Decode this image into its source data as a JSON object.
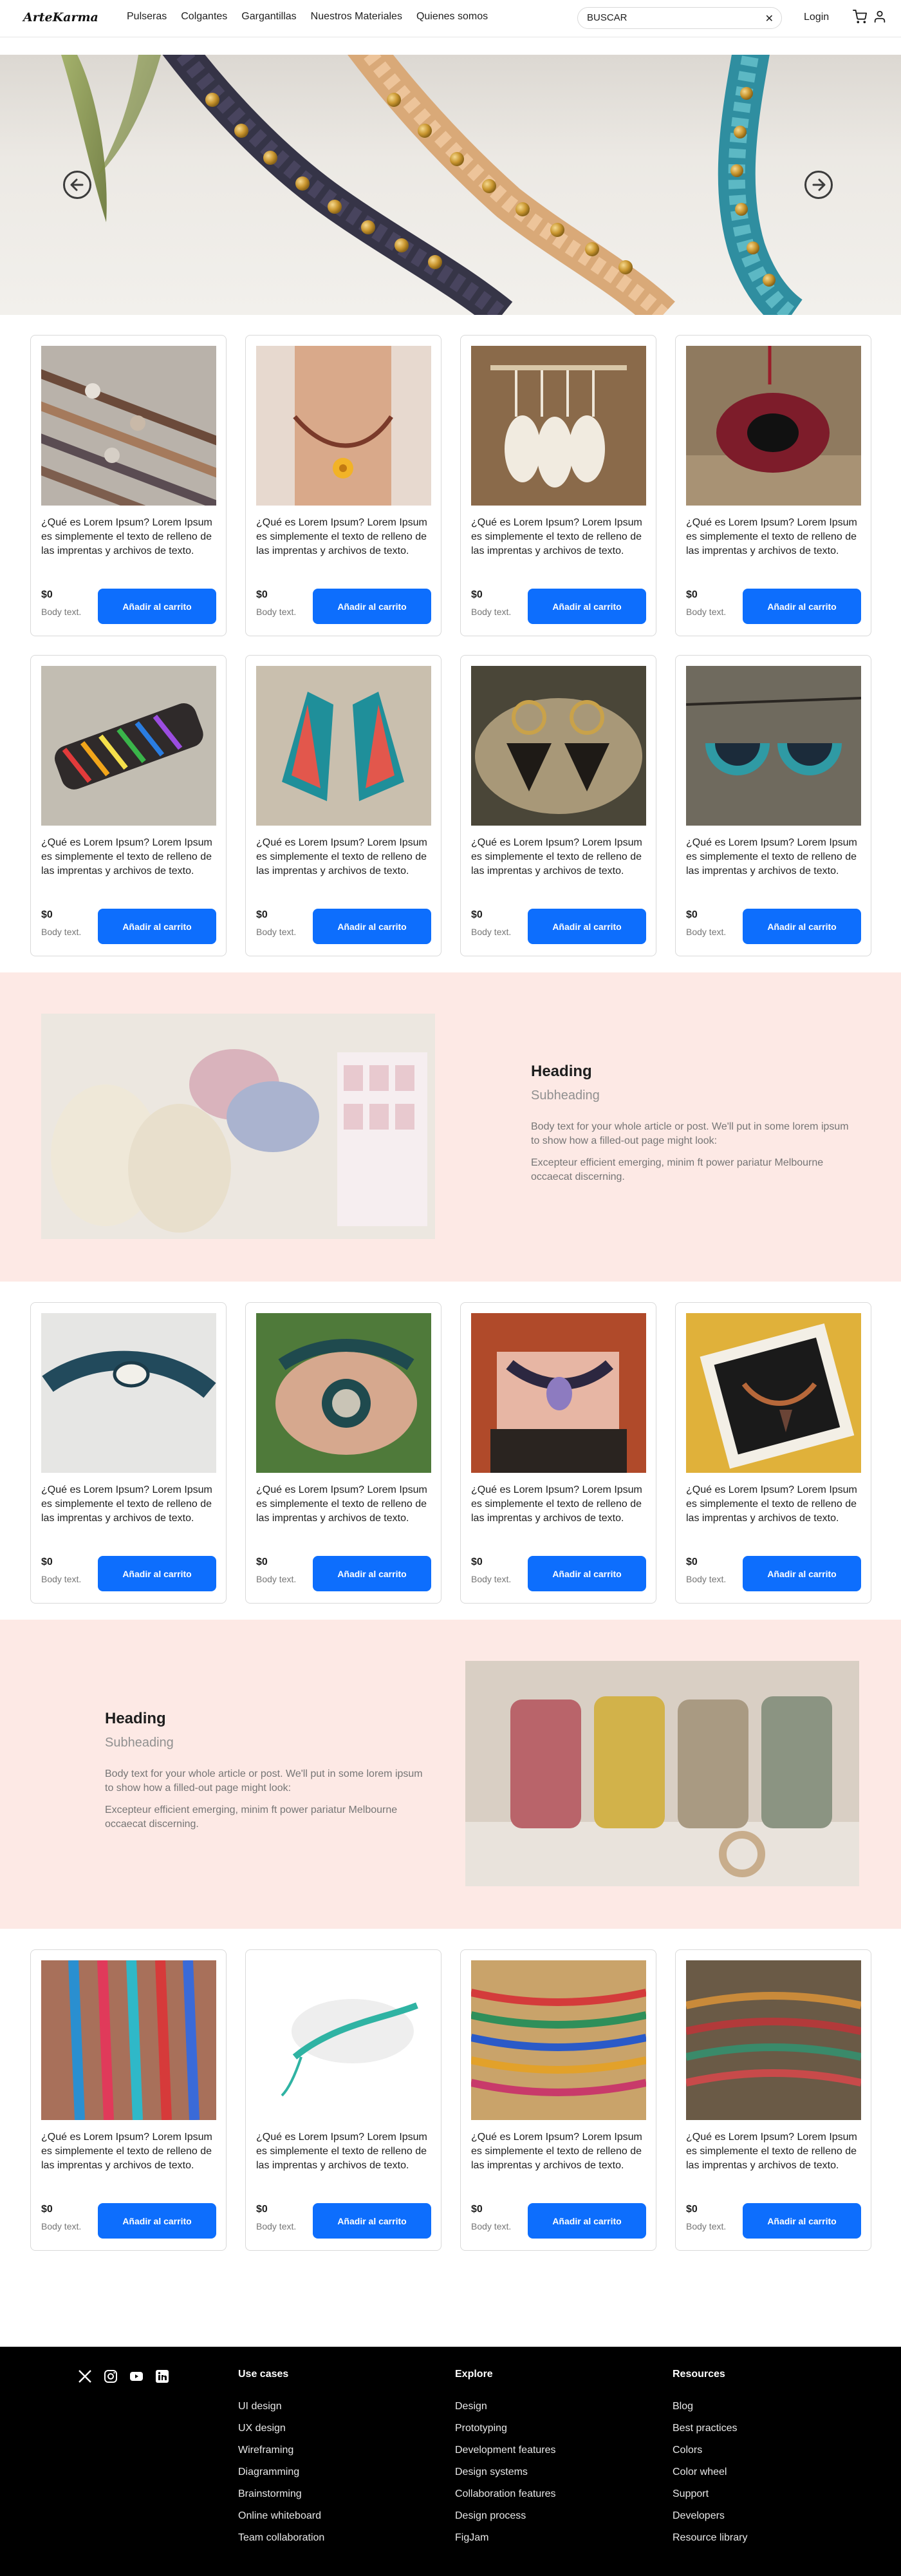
{
  "nav": {
    "logo": "ArteKarma",
    "links": [
      "Pulseras",
      "Colgantes",
      "Gargantillas",
      "Nuestros Materiales",
      "Quienes somos"
    ],
    "search_value": "BUSCAR",
    "login": "Login"
  },
  "product": {
    "text": "¿Qué es Lorem Ipsum? Lorem Ipsum es simplemente el texto de relleno de las imprentas y archivos de texto.",
    "price": "$0",
    "sub": "Body text.",
    "button": "Añadir al carrito"
  },
  "feature1": {
    "heading": "Heading",
    "subheading": "Subheading",
    "body": "Body text for your whole article or post. We'll put in some lorem ipsum to show how a filled-out page might look:",
    "body2": "Excepteur efficient emerging, minim ft power pariatur Melbourne occaecat discerning."
  },
  "feature2": {
    "heading": "Heading",
    "subheading": "Subheading",
    "body": "Body text for your whole article or post. We'll put in some lorem ipsum to show how a filled-out page might look:",
    "body2": "Excepteur efficient emerging, minim ft power pariatur Melbourne occaecat discerning."
  },
  "footer": {
    "columns": [
      {
        "title": "Use cases",
        "items": [
          "UI design",
          "UX design",
          "Wireframing",
          "Diagramming",
          "Brainstorming",
          "Online whiteboard",
          "Team collaboration"
        ]
      },
      {
        "title": "Explore",
        "items": [
          "Design",
          "Prototyping",
          "Development features",
          "Design systems",
          "Collaboration features",
          "Design process",
          "FigJam"
        ]
      },
      {
        "title": "Resources",
        "items": [
          "Blog",
          "Best practices",
          "Colors",
          "Color wheel",
          "Support",
          "Developers",
          "Resource library"
        ]
      }
    ],
    "social_icons": [
      "x-icon",
      "instagram-icon",
      "youtube-icon",
      "linkedin-icon"
    ]
  },
  "colors": {
    "accent": "#0d6efd",
    "band_bg": "#fde9e5",
    "footer_bg": "#000000"
  }
}
